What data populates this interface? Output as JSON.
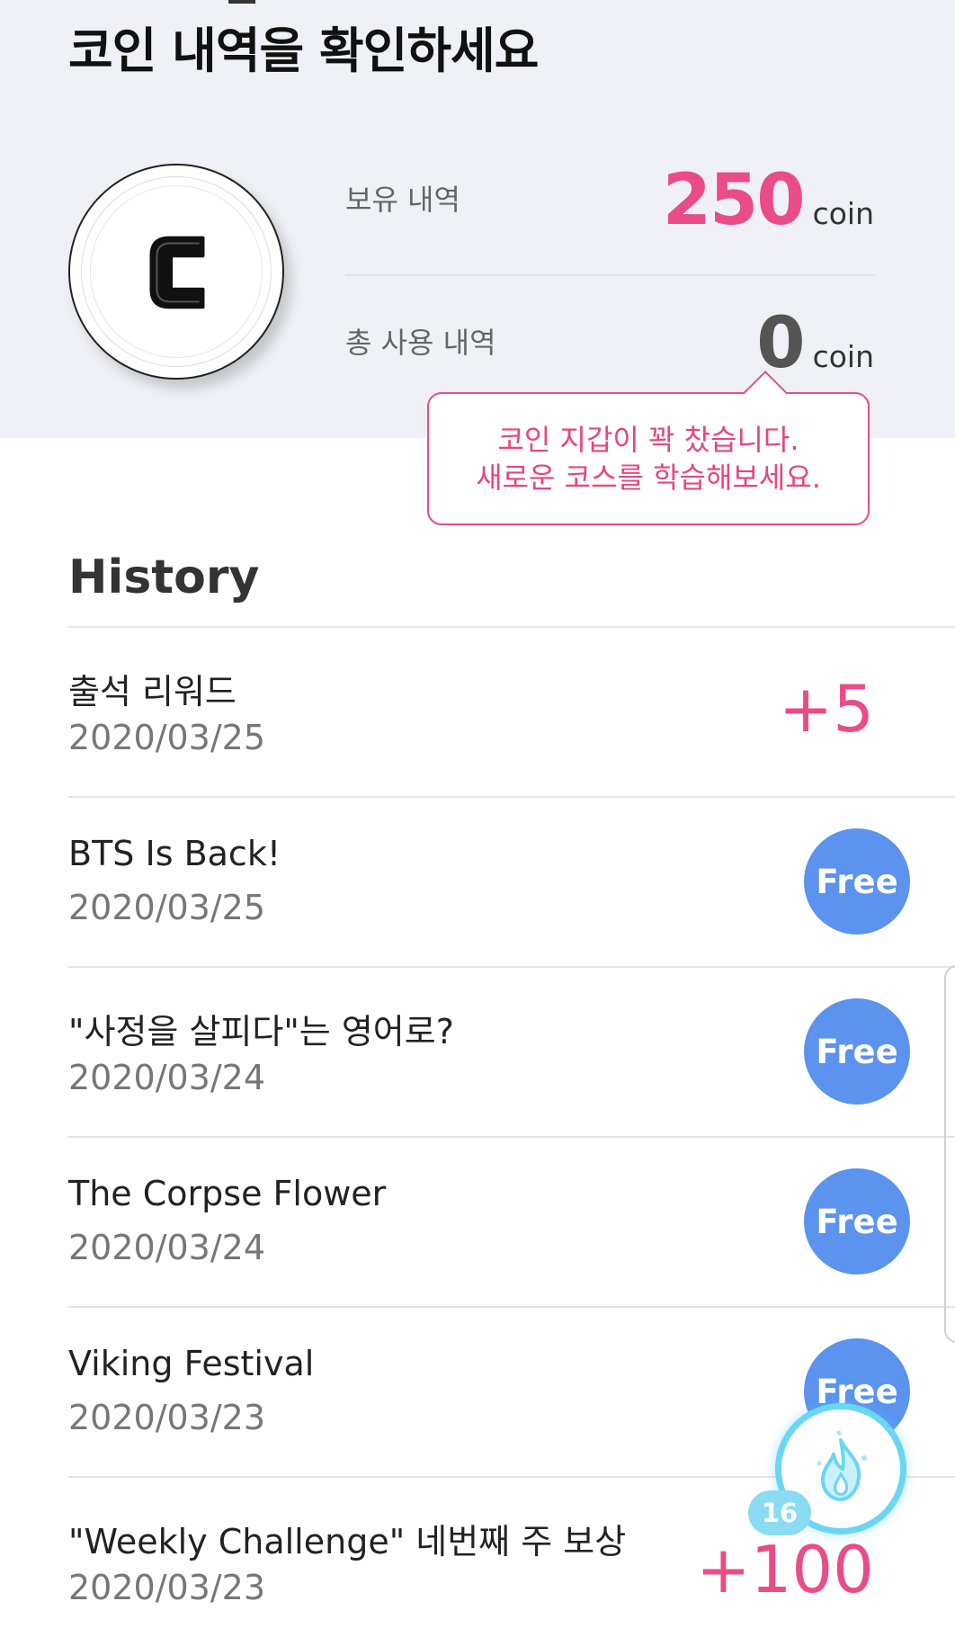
{
  "header": {
    "title": "코인 내역을 확인하세요"
  },
  "coin_summary": {
    "held_label": "보유 내역",
    "held_value": "250",
    "held_unit": "coin",
    "used_label": "총 사용 내역",
    "used_value": "0",
    "used_unit": "coin"
  },
  "notice": {
    "line1": "코인 지갑이 꽉 찼습니다.",
    "line2": "새로운 코스를 학습해보세요."
  },
  "history": {
    "title": "History",
    "items": [
      {
        "title": "출석 리워드",
        "date": "2020/03/25",
        "amount": "+5",
        "type": "amount"
      },
      {
        "title": "BTS Is Back!",
        "date": "2020/03/25",
        "badge": "Free",
        "type": "free"
      },
      {
        "title": "\"사정을 살피다\"는 영어로?",
        "date": "2020/03/24",
        "badge": "Free",
        "type": "free"
      },
      {
        "title": "The Corpse Flower",
        "date": "2020/03/24",
        "badge": "Free",
        "type": "free"
      },
      {
        "title": "Viking Festival",
        "date": "2020/03/23",
        "badge": "Free",
        "type": "free"
      },
      {
        "title": "\"Weekly Challenge\" 네번째 주 보상",
        "date": "2020/03/23",
        "amount": "+100",
        "type": "amount"
      }
    ]
  },
  "fab": {
    "icon": "flame-icon",
    "badge": "16"
  },
  "colors": {
    "accent_pink": "#ea4c89",
    "free_blue": "#5b93ee",
    "header_bg": "#f0f1f6",
    "fab_cyan": "#6ad6f4"
  }
}
